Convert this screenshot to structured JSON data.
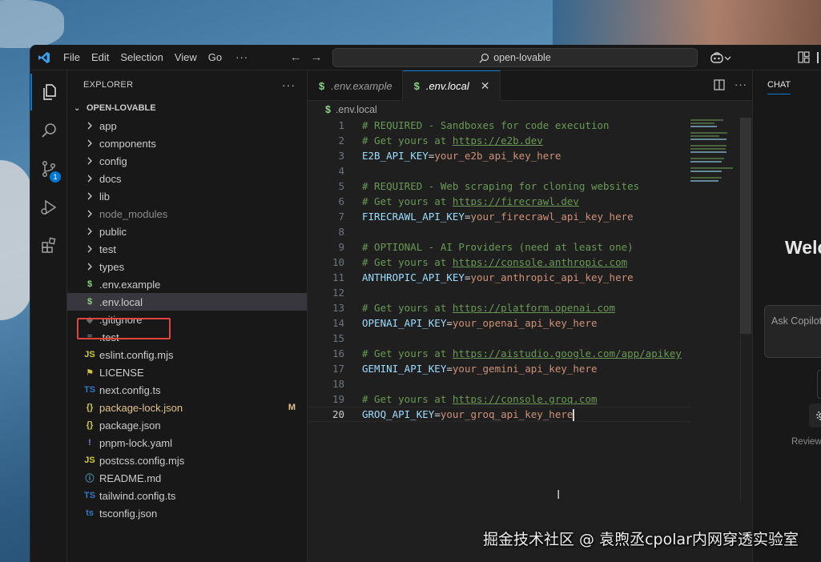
{
  "menu": {
    "file": "File",
    "edit": "Edit",
    "selection": "Selection",
    "view": "View",
    "go": "Go",
    "more": "···"
  },
  "search": {
    "text": "open-lovable"
  },
  "activity": {
    "scm_badge": "1"
  },
  "sidebar": {
    "title": "EXPLORER",
    "more": "···",
    "root": "OPEN-LOVABLE",
    "items": [
      {
        "label": "app",
        "kind": "folder"
      },
      {
        "label": "components",
        "kind": "folder"
      },
      {
        "label": "config",
        "kind": "folder"
      },
      {
        "label": "docs",
        "kind": "folder"
      },
      {
        "label": "lib",
        "kind": "folder"
      },
      {
        "label": "node_modules",
        "kind": "folder"
      },
      {
        "label": "public",
        "kind": "folder"
      },
      {
        "label": "test",
        "kind": "folder"
      },
      {
        "label": "types",
        "kind": "folder"
      },
      {
        "label": ".env.example",
        "icon": "$"
      },
      {
        "label": ".env.local",
        "icon": "$"
      },
      {
        "label": ".gitignore",
        "icon": "◆"
      },
      {
        "label": ".test",
        "icon": "≡"
      },
      {
        "label": "eslint.config.mjs",
        "icon": "JS"
      },
      {
        "label": "LICENSE",
        "icon": "⚑"
      },
      {
        "label": "next.config.ts",
        "icon": "TS"
      },
      {
        "label": "package-lock.json",
        "icon": "{}",
        "status": "M"
      },
      {
        "label": "package.json",
        "icon": "{}"
      },
      {
        "label": "pnpm-lock.yaml",
        "icon": "!"
      },
      {
        "label": "postcss.config.mjs",
        "icon": "JS"
      },
      {
        "label": "README.md",
        "icon": "ⓘ"
      },
      {
        "label": "tailwind.config.ts",
        "icon": "TS"
      },
      {
        "label": "tsconfig.json",
        "icon": "ts"
      }
    ]
  },
  "tabs": [
    {
      "label": ".env.example",
      "icon": "$"
    },
    {
      "label": ".env.local",
      "icon": "$",
      "close": "✕"
    }
  ],
  "breadcrumb": {
    "icon": "$",
    "label": ".env.local"
  },
  "code": {
    "lines": [
      {
        "n": "1",
        "c": "# REQUIRED - Sandboxes for code execution"
      },
      {
        "n": "2",
        "c": "# Get yours at ",
        "u": "https://e2b.dev"
      },
      {
        "n": "3",
        "k": "E2B_API_KEY",
        "v": "your_e2b_api_key_here"
      },
      {
        "n": "4"
      },
      {
        "n": "5",
        "c": "# REQUIRED - Web scraping for cloning websites"
      },
      {
        "n": "6",
        "c": "# Get yours at ",
        "u": "https://firecrawl.dev"
      },
      {
        "n": "7",
        "k": "FIRECRAWL_API_KEY",
        "v": "your_firecrawl_api_key_here"
      },
      {
        "n": "8"
      },
      {
        "n": "9",
        "c": "# OPTIONAL - AI Providers (need at least one)"
      },
      {
        "n": "10",
        "c": "# Get yours at ",
        "u": "https://console.anthropic.com"
      },
      {
        "n": "11",
        "k": "ANTHROPIC_API_KEY",
        "v": "your_anthropic_api_key_here"
      },
      {
        "n": "12"
      },
      {
        "n": "13",
        "c": "# Get yours at ",
        "u": "https://platform.openai.com"
      },
      {
        "n": "14",
        "k": "OPENAI_API_KEY",
        "v": "your_openai_api_key_here"
      },
      {
        "n": "15"
      },
      {
        "n": "16",
        "c": "# Get yours at ",
        "u": "https://aistudio.google.com/app/apikey"
      },
      {
        "n": "17",
        "k": "GEMINI_API_KEY",
        "v": "your_gemini_api_key_here"
      },
      {
        "n": "18"
      },
      {
        "n": "19",
        "c": "# Get yours at ",
        "u": "https://console.groq.com"
      },
      {
        "n": "20",
        "k": "GROQ_API_KEY",
        "v": "your_groq_api_key_here",
        "current": true
      }
    ]
  },
  "chat": {
    "tab": "CHAT",
    "welcome": "Welc",
    "input_placeholder": "Ask Copilot",
    "review": "Review"
  },
  "watermark": "掘金技术社区 @ 袁煦丞cpolar内网穿透实验室",
  "colors": {
    "accent": "#0078d4",
    "highlight": "#e0443e",
    "modified": "#e2c08d"
  }
}
